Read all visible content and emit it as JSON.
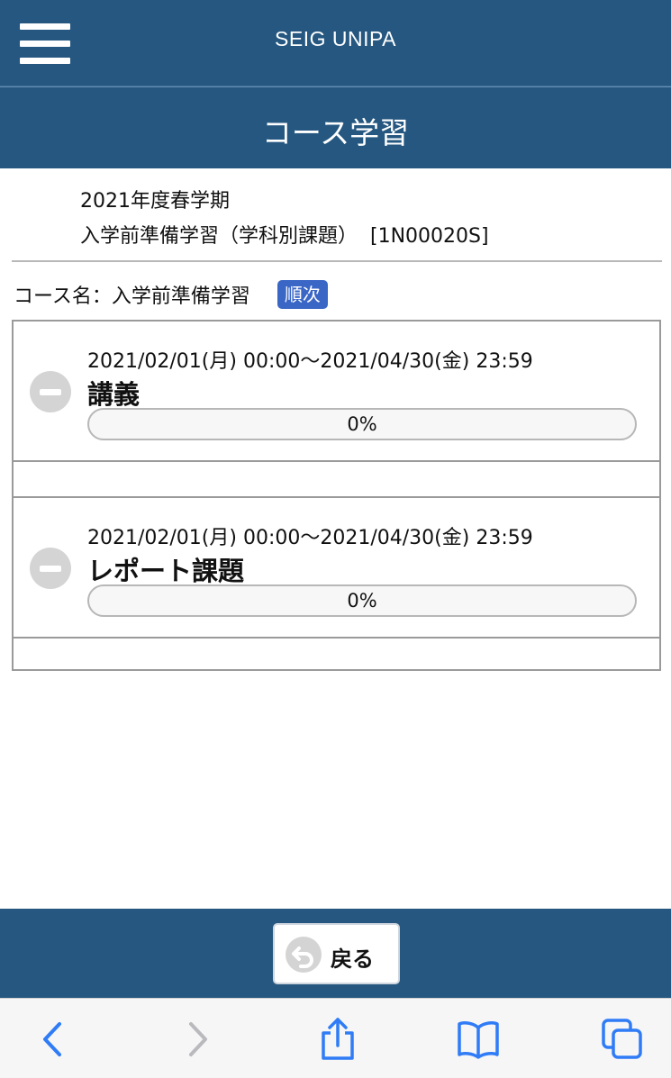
{
  "app": {
    "title": "SEIG UNIPA"
  },
  "page": {
    "title": "コース学習"
  },
  "course": {
    "term": "2021年度春学期",
    "code_line": "入学前準備学習（学科別課題）  [1N00020S]",
    "name_line": "コース名：入学前準備学習",
    "order_badge": "順次"
  },
  "units": [
    {
      "period": "2021/02/01(月) 00:00～2021/04/30(金) 23:59",
      "name": "講義",
      "progress_text": "0%",
      "progress_value": 0
    },
    {
      "period": "2021/02/01(月) 00:00～2021/04/30(金) 23:59",
      "name": "レポート課題",
      "progress_text": "0%",
      "progress_value": 0
    }
  ],
  "footer": {
    "back_label": "戻る"
  },
  "icons": {
    "menu": "hamburger-menu-icon",
    "unit_status": "minus-circle-icon",
    "back": "undo-arrow-icon",
    "browser": [
      "chevron-left-icon",
      "chevron-right-icon",
      "share-icon",
      "bookmarks-icon",
      "tabs-icon"
    ]
  },
  "colors": {
    "header": "#255780",
    "badge": "#3a66c6",
    "safari_tint": "#2f7cf6",
    "disabled": "#b9b9be"
  }
}
